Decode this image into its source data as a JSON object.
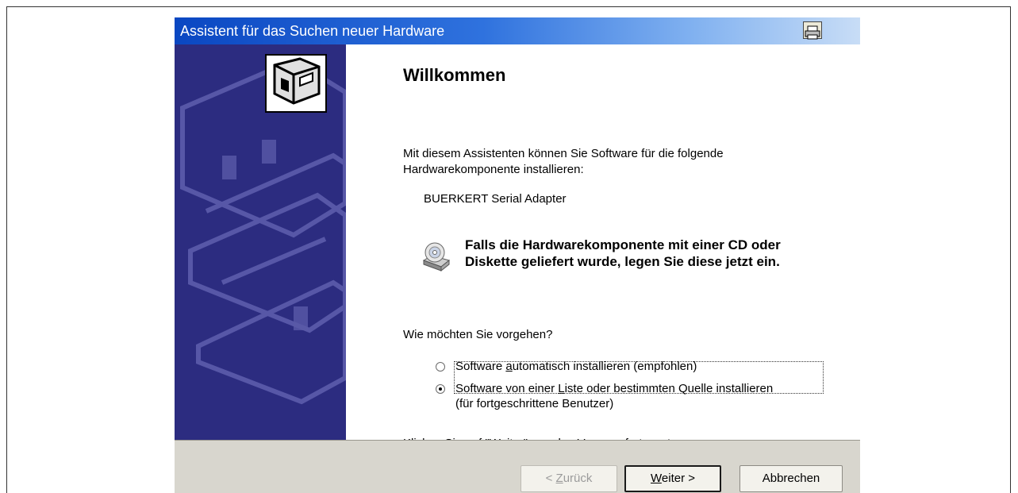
{
  "window": {
    "title": "Assistent für das Suchen neuer Hardware"
  },
  "content": {
    "heading": "Willkommen",
    "intro_line1": "Mit diesem Assistenten können Sie Software für die folgende",
    "intro_line2": "Hardwarekomponente installieren:",
    "device_name": "BUERKERT Serial Adapter",
    "cd_note_line1": "Falls die Hardwarekomponente mit einer CD oder",
    "cd_note_line2": "Diskette geliefert wurde, legen Sie diese jetzt ein.",
    "question": "Wie möchten Sie vorgehen?",
    "options": [
      {
        "label_pre": "Software ",
        "label_underline": "a",
        "label_post": "utomatisch installieren (empfohlen)",
        "selected": false
      },
      {
        "label_pre": "Software von einer ",
        "label_underline": "L",
        "label_post": "iste oder bestimmten Quelle installieren",
        "label_line2": "(für fortgeschrittene Benutzer)",
        "selected": true
      }
    ],
    "continue_hint": "Klicken Sie auf \"Weiter\", um den Vorgang fortzusetzen."
  },
  "buttons": {
    "back_prefix": "< ",
    "back_underline": "Z",
    "back_rest": "urück",
    "next_underline": "W",
    "next_rest": "eiter >",
    "cancel": "Abbrechen"
  }
}
